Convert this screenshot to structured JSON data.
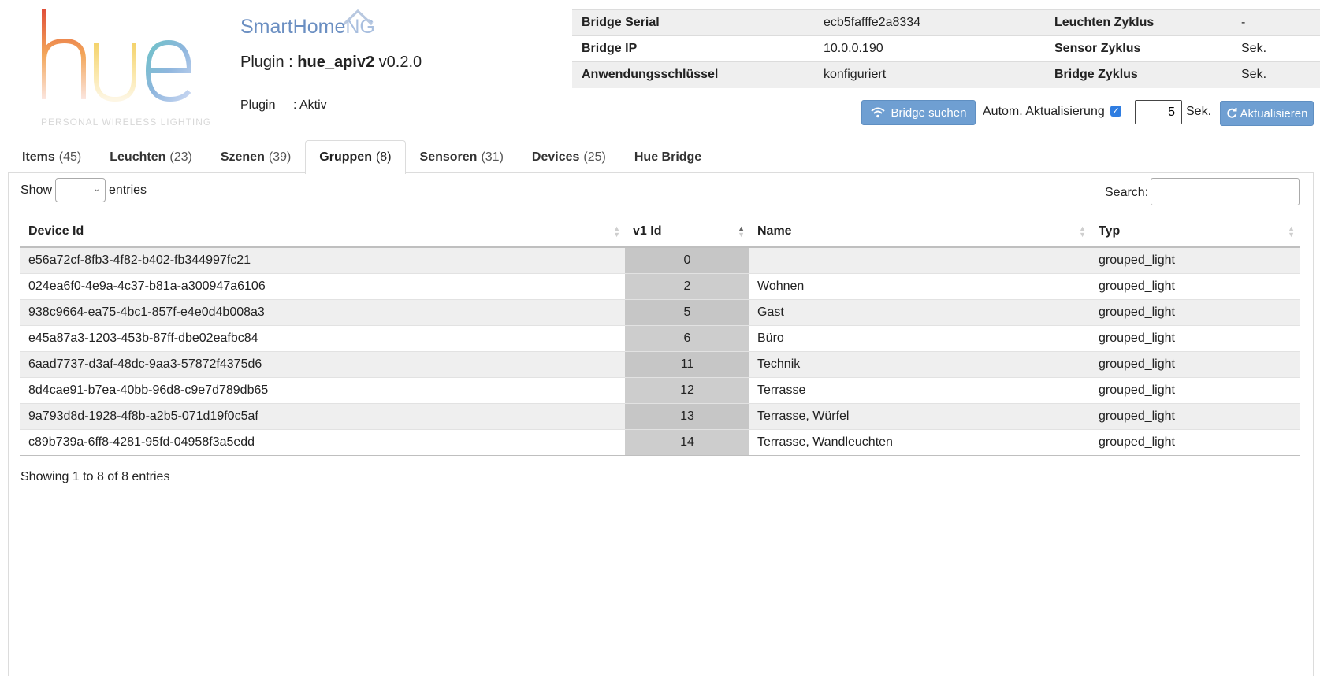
{
  "logos": {
    "hue_wordmark": "hue",
    "hue_subtitle": "PERSONAL WIRELESS LIGHTING",
    "shng_main": "SmartHome",
    "shng_ng": "NG"
  },
  "plugin": {
    "title_prefix": "Plugin : ",
    "title_name": "hue_apiv2",
    "title_version": " v0.2.0",
    "state_label": "Plugin",
    "state_value": ": Aktiv"
  },
  "info": {
    "rows": [
      {
        "k1": "Bridge Serial",
        "v1": "ecb5fafffe2a8334",
        "k2": "Leuchten Zyklus",
        "v2": "-"
      },
      {
        "k1": "Bridge IP",
        "v1": "10.0.0.190",
        "k2": "Sensor Zyklus",
        "v2": "Sek."
      },
      {
        "k1": "Anwendungsschlüssel",
        "v1": "konfiguriert",
        "k2": "Bridge Zyklus",
        "v2": "Sek."
      }
    ]
  },
  "toolbar": {
    "bridge_search": "Bridge suchen",
    "auto_update_label": "Autom. Aktualisierung",
    "auto_update_checked": true,
    "interval_value": "5",
    "interval_unit": "Sek.",
    "refresh": "Aktualisieren"
  },
  "tabs": [
    {
      "label": "Items",
      "count": "(45)",
      "active": false
    },
    {
      "label": "Leuchten",
      "count": "(23)",
      "active": false
    },
    {
      "label": "Szenen",
      "count": "(39)",
      "active": false
    },
    {
      "label": "Gruppen",
      "count": "(8)",
      "active": true
    },
    {
      "label": "Sensoren",
      "count": "(31)",
      "active": false
    },
    {
      "label": "Devices",
      "count": "(25)",
      "active": false
    },
    {
      "label": "Hue Bridge",
      "count": "",
      "active": false
    }
  ],
  "datatable": {
    "show_label": "Show",
    "entries_label": "entries",
    "search_label": "Search:",
    "search_value": "",
    "columns": [
      "Device Id",
      "v1 Id",
      "Name",
      "Typ"
    ],
    "rows": [
      [
        "e56a72cf-8fb3-4f82-b402-fb344997fc21",
        "0",
        "",
        "grouped_light"
      ],
      [
        "024ea6f0-4e9a-4c37-b81a-a300947a6106",
        "2",
        "Wohnen",
        "grouped_light"
      ],
      [
        "938c9664-ea75-4bc1-857f-e4e0d4b008a3",
        "5",
        "Gast",
        "grouped_light"
      ],
      [
        "e45a87a3-1203-453b-87ff-dbe02eafbc84",
        "6",
        "Büro",
        "grouped_light"
      ],
      [
        "6aad7737-d3af-48dc-9aa3-57872f4375d6",
        "11",
        "Technik",
        "grouped_light"
      ],
      [
        "8d4cae91-b7ea-40bb-96d8-c9e7d789db65",
        "12",
        "Terrasse",
        "grouped_light"
      ],
      [
        "9a793d8d-1928-4f8b-a2b5-071d19f0c5af",
        "13",
        "Terrasse, Würfel",
        "grouped_light"
      ],
      [
        "c89b739a-6ff8-4281-95fd-04958f3a5edd",
        "14",
        "Terrasse, Wandleuchten",
        "grouped_light"
      ]
    ],
    "info": "Showing 1 to 8 of 8 entries"
  },
  "colors": {
    "button_blue": "#6f9fd2",
    "row_stripe": "#efefef",
    "sorted_column": "#cdcdcd"
  }
}
